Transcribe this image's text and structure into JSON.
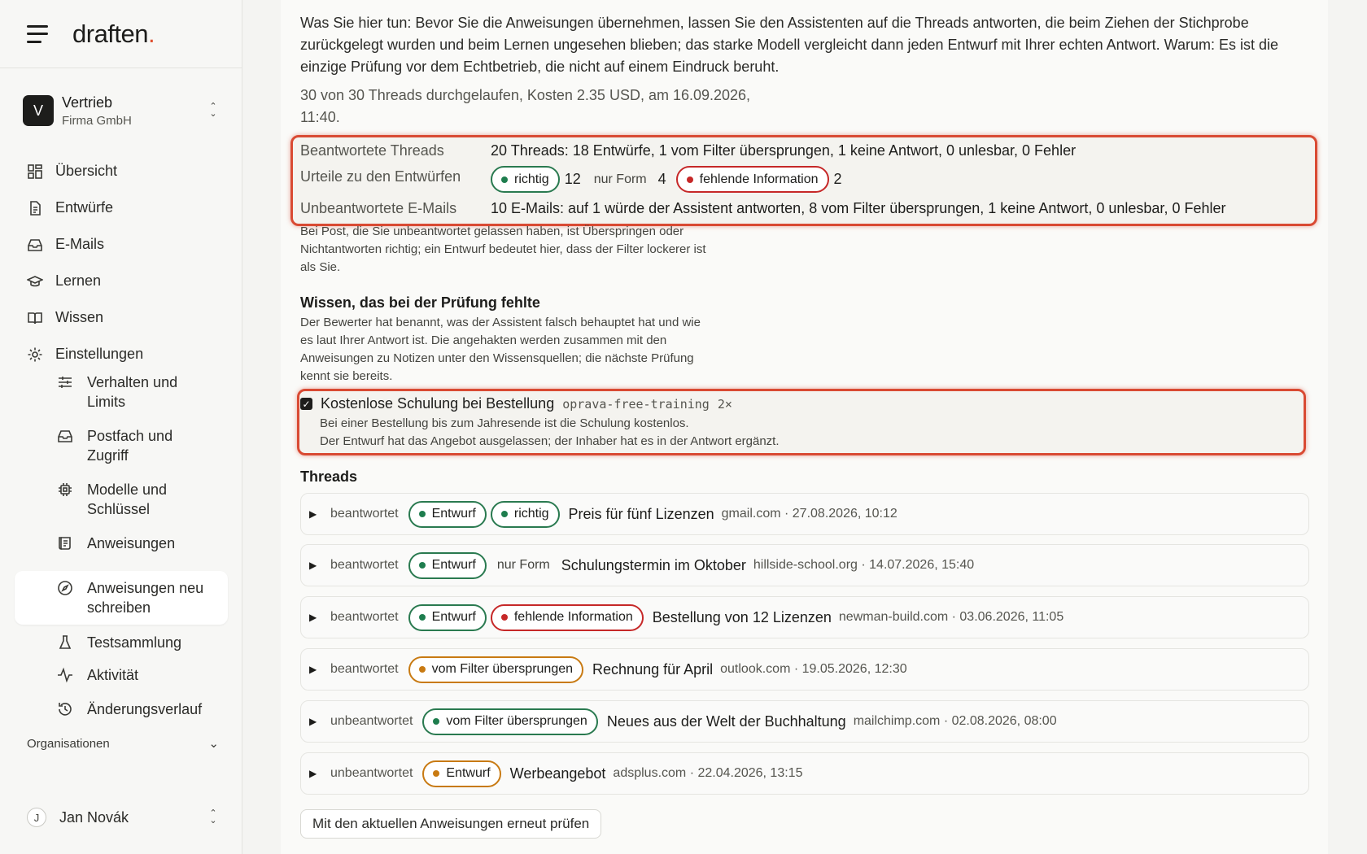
{
  "app": {
    "logo": "draften",
    "logo_dot": "."
  },
  "workspace": {
    "initial": "V",
    "name": "Vertrieb",
    "company": "Firma GmbH"
  },
  "nav": {
    "overview": "Übersicht",
    "drafts": "Entwürfe",
    "emails": "E-Mails",
    "learn": "Lernen",
    "knowledge": "Wissen",
    "settings": "Einstellungen"
  },
  "subnav": {
    "behavior": "Verhalten und Limits",
    "mailbox": "Postfach und Zugriff",
    "models": "Modelle und Schlüssel",
    "instructions": "Anweisungen",
    "rewrite": "Anweisungen neu schreiben",
    "testset": "Testsammlung",
    "activity": "Aktivität",
    "history": "Änderungsverlauf"
  },
  "organisations_label": "Organisationen",
  "user": {
    "initial": "J",
    "name": "Jan Novák"
  },
  "intro_text": "Was Sie hier tun: Bevor Sie die Anweisungen übernehmen, lassen Sie den Assistenten auf die Threads antworten, die beim Ziehen der Stichprobe zurückgelegt wurden und beim Lernen ungesehen blieben; das starke Modell vergleicht dann jeden Entwurf mit Ihrer echten Antwort. Warum: Es ist die einzige Prüfung vor dem Echtbetrieb, die nicht auf einem Eindruck beruht.",
  "run_info": "30 von 30 Threads durchgelaufen, Kosten 2.35 USD, am 16.09.2026, 11:40.",
  "summary": {
    "answered_label": "Beantwortete Threads",
    "answered_value": "20 Threads: 18 Entwürfe, 1 vom Filter übersprungen, 1 keine Antwort, 0 unlesbar, 0 Fehler",
    "verdicts_label": "Urteile zu den Entwürfen",
    "verdict_correct": "richtig",
    "verdict_correct_count": "12",
    "verdict_form": "nur Form",
    "verdict_form_count": "4",
    "verdict_missing": "fehlende Information",
    "verdict_missing_count": "2",
    "unanswered_label": "Unbeantwortete E-Mails",
    "unanswered_value": "10 E-Mails: auf 1 würde der Assistent antworten, 8 vom Filter übersprungen, 1 keine Antwort, 0 unlesbar, 0 Fehler"
  },
  "unanswered_note": "Bei Post, die Sie unbeantwortet gelassen haben, ist Überspringen oder Nichtantworten richtig; ein Entwurf bedeutet hier, dass der Filter lockerer ist als Sie.",
  "knowledge_section": {
    "title": "Wissen, das bei der Prüfung fehlte",
    "description": "Der Bewerter hat benannt, was der Assistent falsch behauptet hat und wie es laut Ihrer Antwort ist. Die angehakten werden zusammen mit den Anweisungen zu Notizen unter den Wissensquellen; die nächste Prüfung kennt sie bereits.",
    "item": {
      "checked": true,
      "title": "Kostenlose Schulung bei Bestellung",
      "code": "oprava-free-training",
      "times": "2×",
      "fact": "Bei einer Bestellung bis zum Jahresende ist die Schulung kostenlos.",
      "reason": "Der Entwurf hat das Angebot ausgelassen; der Inhaber hat es in der Antwort ergänzt."
    }
  },
  "threads_title": "Threads",
  "threads": [
    {
      "status": "beantwortet",
      "kind": "Entwurf",
      "verdict": "richtig",
      "subject": "Preis für fünf Lizenzen",
      "meta": "gmail.com · 27.08.2026, 10:12"
    },
    {
      "status": "beantwortet",
      "kind": "Entwurf",
      "verdict": "nur Form",
      "subject": "Schulungstermin im Oktober",
      "meta": "hillside-school.org · 14.07.2026, 15:40"
    },
    {
      "status": "beantwortet",
      "kind": "Entwurf",
      "verdict": "fehlende Information",
      "subject": "Bestellung von 12 Lizenzen",
      "meta": "newman-build.com · 03.06.2026, 11:05"
    },
    {
      "status": "beantwortet",
      "kind": "vom Filter übersprungen",
      "subject": "Rechnung für April",
      "meta": "outlook.com · 19.05.2026, 12:30"
    },
    {
      "status": "unbeantwortet",
      "kind": "vom Filter übersprungen",
      "subject": "Neues aus der Welt der Buchhaltung",
      "meta": "mailchimp.com · 02.08.2026, 08:00"
    },
    {
      "status": "unbeantwortet",
      "kind": "Entwurf",
      "subject": "Werbeangebot",
      "meta": "adsplus.com · 22.04.2026, 13:15"
    }
  ],
  "recheck_button": "Mit den aktuellen Anweisungen erneut prüfen",
  "colors": {
    "accent": "#e0502f",
    "highlight": "#d94a33",
    "ok_green": "#1e7d4e",
    "error_red": "#c62828",
    "warn_orange": "#c87a12"
  },
  "icons": {
    "menu": "menu-icon",
    "overview": "grid-icon",
    "drafts": "document-icon",
    "emails": "inbox-icon",
    "learn": "graduation-cap-icon",
    "knowledge": "book-icon",
    "settings": "gear-icon"
  }
}
